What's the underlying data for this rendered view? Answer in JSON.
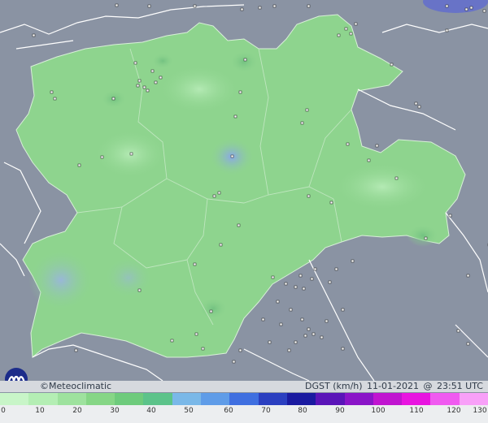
{
  "brand": {
    "copyright": "©Meteoclimatic",
    "logo_name": "meteoclimatic-logo"
  },
  "header": {
    "variable": "DGST (km/h)",
    "date": "11-01-2021",
    "at": "@",
    "time": "23:51 UTC"
  },
  "legend": {
    "ticks": [
      "0",
      "10",
      "20",
      "30",
      "40",
      "50",
      "60",
      "70",
      "80",
      "90",
      "100",
      "110",
      "120",
      "130"
    ],
    "colors": [
      "#c8f5c8",
      "#b4eeb4",
      "#9ee29e",
      "#86d686",
      "#6ecb7c",
      "#5cc38a",
      "#7ab8e8",
      "#5f9ce8",
      "#3f6fe0",
      "#2b3fc0",
      "#1a1aa0",
      "#5a14b8",
      "#8a14c8",
      "#c014d0",
      "#e814e0",
      "#f05af0",
      "#f8a0f8"
    ]
  },
  "map": {
    "land_color": "#8c95a5",
    "region_color": "#8ed48e",
    "region_highlight": "#a8e4a8",
    "hotspot_color": "#8aa8e8",
    "border_color": "#ffffff"
  }
}
